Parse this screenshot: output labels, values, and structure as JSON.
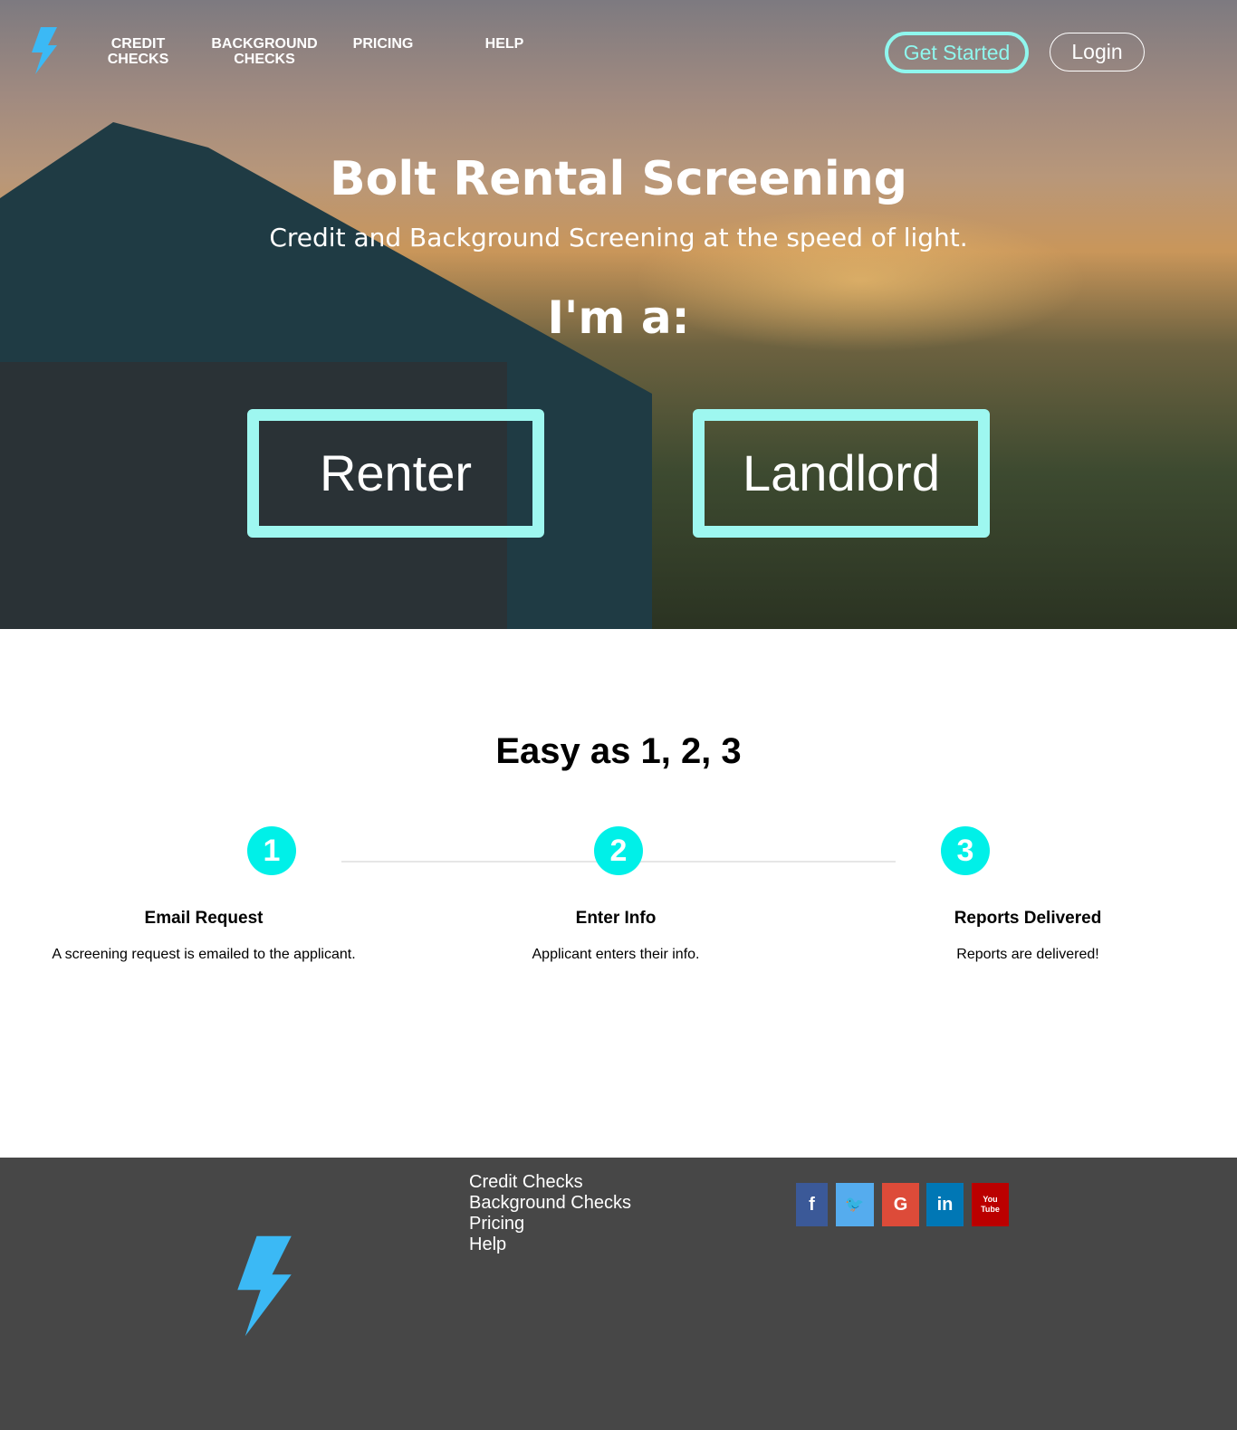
{
  "nav": {
    "items": [
      "CREDIT CHECKS",
      "BACKGROUND CHECKS",
      "PRICING",
      "HELP"
    ],
    "get_started": "Get Started",
    "login": "Login"
  },
  "hero": {
    "title": "Bolt Rental Screening",
    "subtitle": "Credit and Background Screening at the speed of light.",
    "prompt": "I'm a:",
    "renter": "Renter",
    "landlord": "Landlord"
  },
  "steps": {
    "title": "Easy as 1, 2, 3",
    "items": [
      {
        "num": "1",
        "title": "Email Request",
        "desc": "A screening request is emailed to the applicant."
      },
      {
        "num": "2",
        "title": "Enter Info",
        "desc": "Applicant enters their info."
      },
      {
        "num": "3",
        "title": "Reports Delivered",
        "desc": "Reports are delivered!"
      }
    ]
  },
  "footer": {
    "links": [
      "Credit Checks",
      "Background Checks",
      "Pricing",
      "Help"
    ],
    "social": [
      {
        "icon": "facebook-icon",
        "glyph": "f",
        "color": "#3b5998"
      },
      {
        "icon": "twitter-icon",
        "glyph": "🐦",
        "color": "#55acee"
      },
      {
        "icon": "google-icon",
        "glyph": "G",
        "color": "#dd4b39"
      },
      {
        "icon": "linkedin-icon",
        "glyph": "in",
        "color": "#0077b5"
      },
      {
        "icon": "youtube-icon",
        "glyph": "You Tube",
        "color": "#bb0000"
      }
    ]
  },
  "colors": {
    "accent": "#00f0e8",
    "logo": "#3bb9f5",
    "footer": "#474747"
  }
}
